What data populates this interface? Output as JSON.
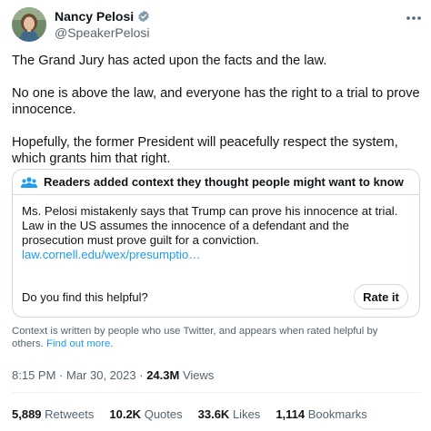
{
  "author": {
    "name": "Nancy Pelosi",
    "handle": "@SpeakerPelosi",
    "verified_color": "#829aab"
  },
  "more_icon": "more-horizontal-icon",
  "tweet": {
    "paragraphs": [
      "The Grand Jury has acted upon the facts and the law.",
      "No one is above the law, and everyone has the right to a trial to prove innocence.",
      "Hopefully, the former President will peacefully respect the system, which grants him that right."
    ]
  },
  "community_note": {
    "header": "Readers added context they thought people might want to know",
    "header_icon": "people-group-icon",
    "body": "Ms. Pelosi mistakenly says that Trump can prove his innocence at trial. Law in the US assumes the innocence of a defendant and the prosecution must prove guilt for a conviction.",
    "link": "law.cornell.edu/wex/presumptio…",
    "helpful_question": "Do you find this helpful?",
    "rate_label": "Rate it"
  },
  "context_footer": {
    "text": "Context is written by people who use Twitter, and appears when rated helpful by others.",
    "find_more": "Find out more."
  },
  "meta": {
    "time": "8:15 PM",
    "date": "Mar 30, 2023",
    "views_count": "24.3M",
    "views_label": "Views"
  },
  "stats": {
    "retweets_count": "5,889",
    "retweets_label": "Retweets",
    "quotes_count": "10.2K",
    "quotes_label": "Quotes",
    "likes_count": "33.6K",
    "likes_label": "Likes",
    "bookmarks_count": "1,114",
    "bookmarks_label": "Bookmarks"
  },
  "colors": {
    "link": "#1d9bf0",
    "secondary_text": "#536471",
    "border": "#cfd9de"
  }
}
